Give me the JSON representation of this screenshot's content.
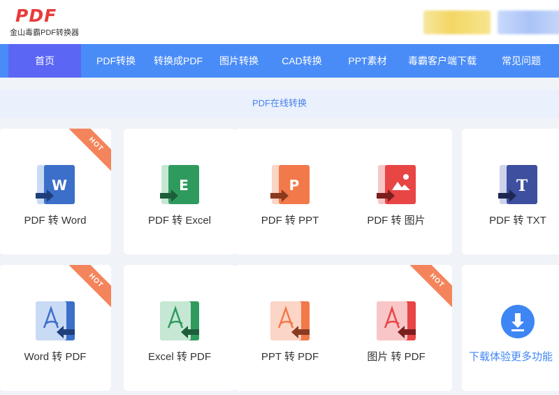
{
  "header": {
    "logo_text": "PDF",
    "logo_sub": "金山毒霸PDF转换器"
  },
  "nav": {
    "items": [
      {
        "label": "首页",
        "active": true
      },
      {
        "label": "PDF转换"
      },
      {
        "label": "转换成PDF"
      },
      {
        "label": "图片转换"
      },
      {
        "label": "CAD转换"
      },
      {
        "label": "PPT素材"
      },
      {
        "label": "毒霸客户端下载"
      },
      {
        "label": "常见问题"
      }
    ]
  },
  "subbar": {
    "label": "PDF在线转换"
  },
  "badge": {
    "hot": "HOT"
  },
  "cards": {
    "row1": [
      {
        "label": "PDF 转 Word",
        "icon": "word-doc-icon",
        "color": "#3b6fc9",
        "hot": true
      },
      {
        "label": "PDF 转 Excel",
        "icon": "excel-doc-icon",
        "color": "#2f9a5e"
      },
      {
        "label": "PDF 转 PPT",
        "icon": "ppt-doc-icon",
        "color": "#f2794a"
      },
      {
        "label": "PDF 转 图片",
        "icon": "image-doc-icon",
        "color": "#e84545"
      },
      {
        "label": "PDF 转 TXT",
        "icon": "txt-doc-icon",
        "color": "#3d4f9e"
      }
    ],
    "row2": [
      {
        "label": "Word 转 PDF",
        "icon": "pdf-from-word-icon",
        "color": "#3b6fc9",
        "hot": true
      },
      {
        "label": "Excel 转 PDF",
        "icon": "pdf-from-excel-icon",
        "color": "#2f9a5e"
      },
      {
        "label": "PPT 转 PDF",
        "icon": "pdf-from-ppt-icon",
        "color": "#f2794a"
      },
      {
        "label": "图片 转 PDF",
        "icon": "pdf-from-image-icon",
        "color": "#e84545",
        "hot": true
      },
      {
        "label": "下载体验更多功能",
        "icon": "download-icon",
        "color": "#3f86f5"
      }
    ]
  }
}
